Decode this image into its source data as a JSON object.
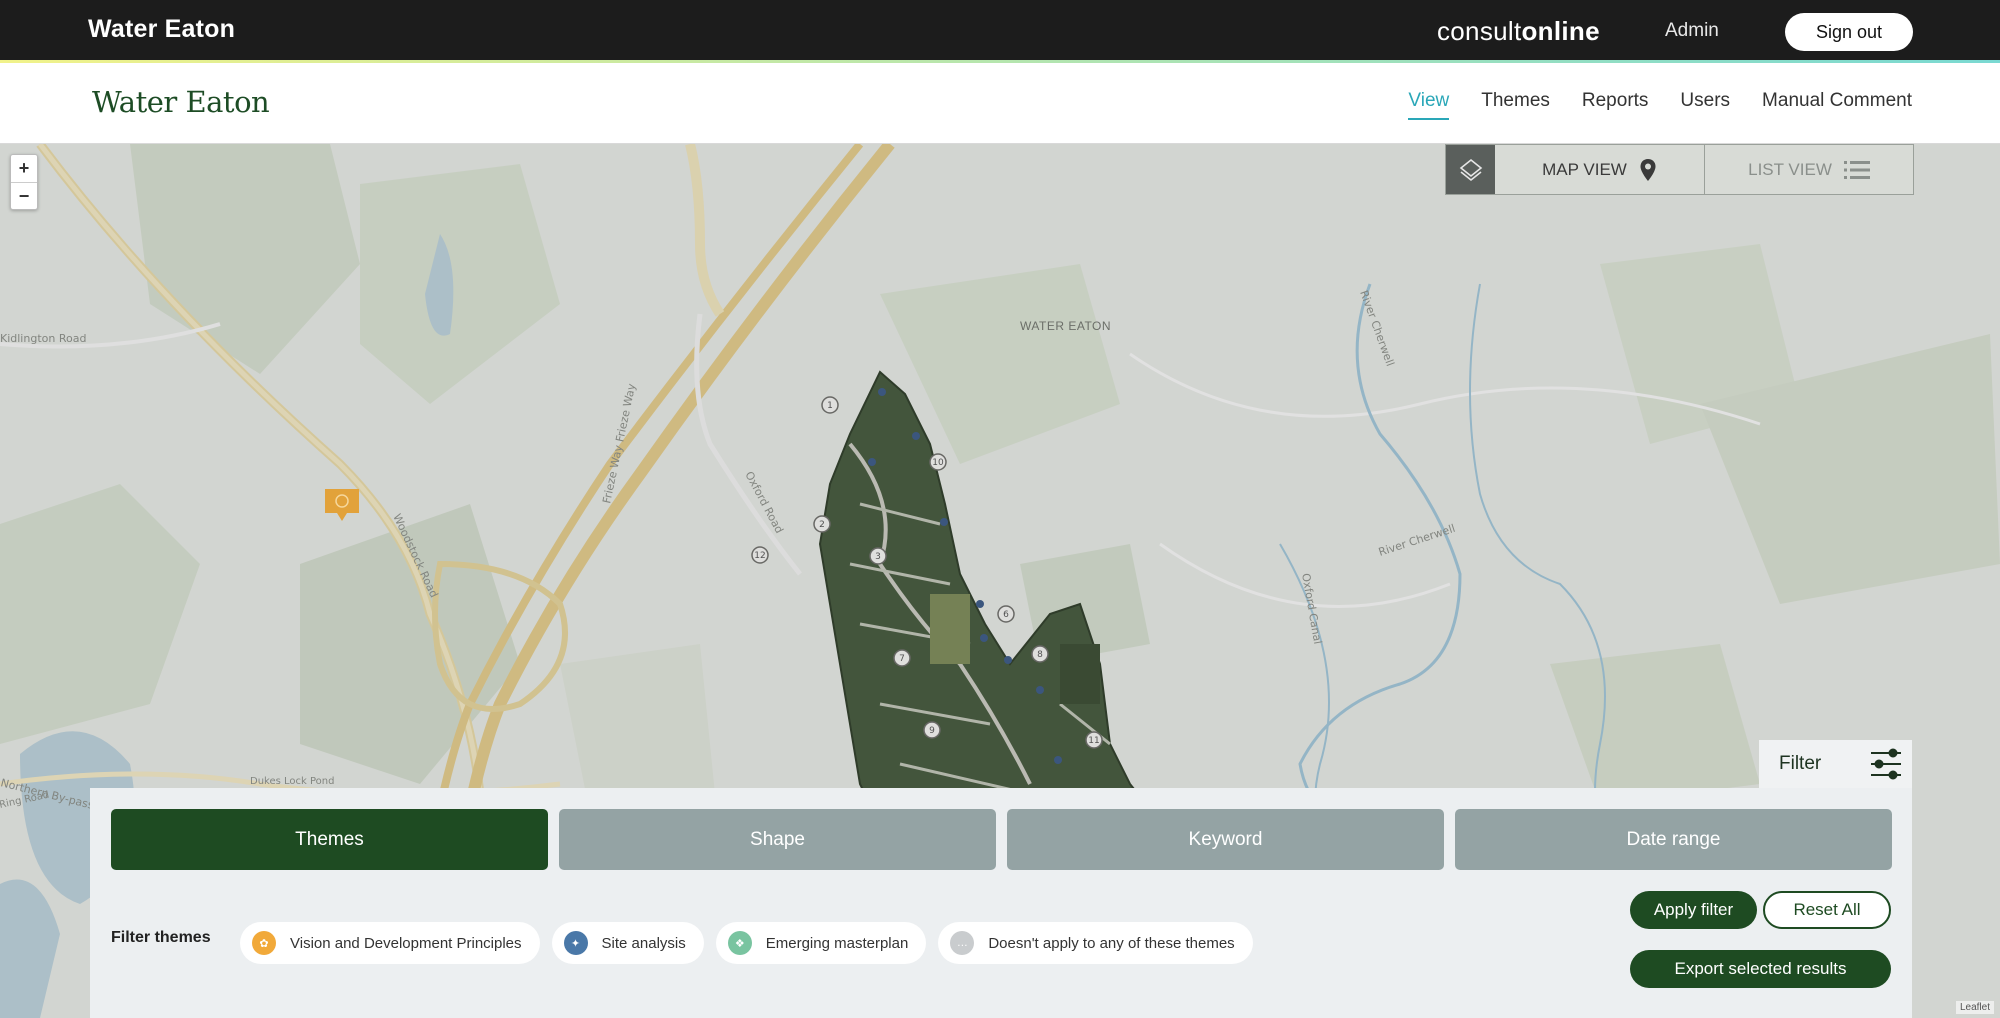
{
  "header": {
    "app_title": "Water Eaton",
    "brand_light": "consult",
    "brand_bold": "online",
    "admin_label": "Admin",
    "signout_label": "Sign out"
  },
  "nav": {
    "logo": "Water Eaton",
    "items": [
      {
        "label": "View",
        "active": true
      },
      {
        "label": "Themes",
        "active": false
      },
      {
        "label": "Reports",
        "active": false
      },
      {
        "label": "Users",
        "active": false
      },
      {
        "label": "Manual Comment",
        "active": false
      }
    ]
  },
  "map": {
    "zoom_in": "+",
    "zoom_out": "−",
    "view_toggle": {
      "map_view_label": "MAP VIEW",
      "list_view_label": "LIST VIEW",
      "active": "map"
    },
    "labels": {
      "place": "WATER EATON",
      "oxford_road": "Oxford Road",
      "frieze_way": "Frieze Way Frieze Way",
      "woodstock_road": "Woodstock Road",
      "kidlington_road": "Kidlington Road",
      "river_cherwell_1": "River Cherwell",
      "river_cherwell_2": "River Cherwell",
      "oxford_canal": "Oxford Canal",
      "dukes_lock_pond": "Dukes Lock Pond",
      "northern_bypass": "Northern By-pass",
      "ring_road": "Ring Road"
    },
    "attribution": "Leaflet"
  },
  "filter": {
    "tab_label": "Filter",
    "tabs": [
      {
        "label": "Themes",
        "active": true
      },
      {
        "label": "Shape",
        "active": false
      },
      {
        "label": "Keyword",
        "active": false
      },
      {
        "label": "Date range",
        "active": false
      }
    ],
    "themes_label": "Filter themes",
    "themes": [
      {
        "label": "Vision and Development Principles",
        "color": "#f1a93a"
      },
      {
        "label": "Site analysis",
        "color": "#4a78a8"
      },
      {
        "label": "Emerging masterplan",
        "color": "#79c4a0"
      },
      {
        "label": "Doesn't apply to any of these themes",
        "color": "#c9ccce"
      }
    ],
    "apply_label": "Apply filter",
    "reset_label": "Reset All",
    "export_label": "Export selected results"
  },
  "colors": {
    "accent_teal": "#2aa7b8",
    "brand_green": "#1e4b22",
    "inactive_tab": "#94a3a4",
    "comment_marker": "#e2a23a"
  }
}
